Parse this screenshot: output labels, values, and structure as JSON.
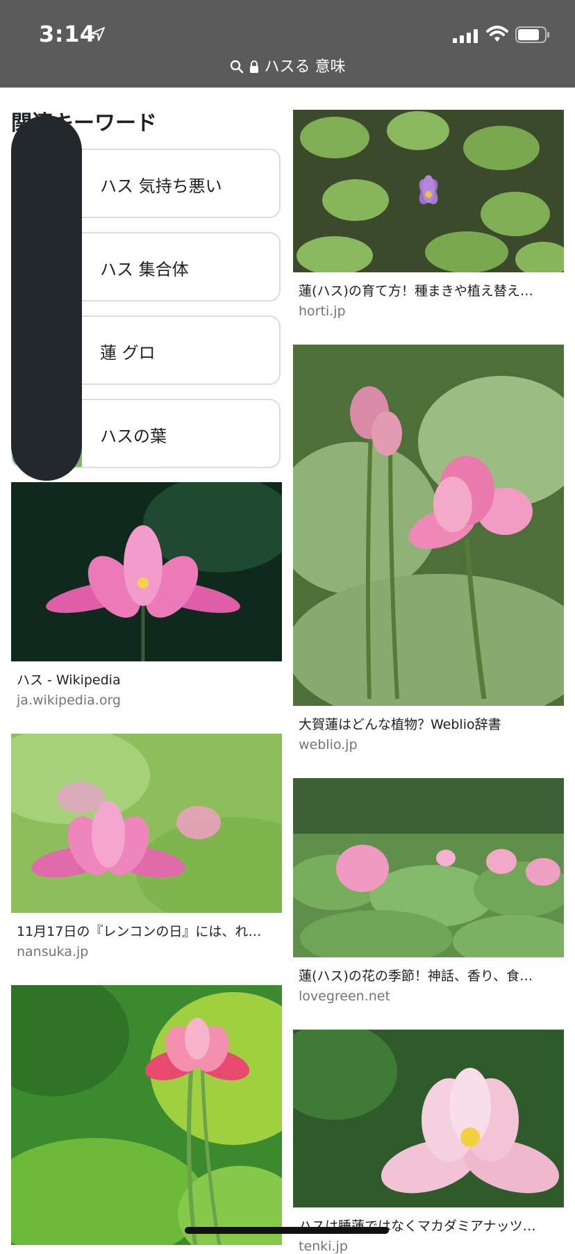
{
  "status": {
    "time": "3:14"
  },
  "urlbar": {
    "text": "ハスる 意味"
  },
  "related": {
    "title": "関連キーワード",
    "items": [
      {
        "label": "ハス 気持ち悪い"
      },
      {
        "label": "ハス 集合体"
      },
      {
        "label": "蓮 グロ"
      },
      {
        "label": "ハスの葉"
      }
    ]
  },
  "results": [
    {
      "caption": "蓮(ハス)の育て方！種まきや植え替え…",
      "source": "horti.jp"
    },
    {
      "caption": "ハス - Wikipedia",
      "source": "ja.wikipedia.org"
    },
    {
      "caption": "大賀蓮はどんな植物？Weblio辞書",
      "source": "weblio.jp"
    },
    {
      "caption": "11月17日の『レンコンの日』には、れ…",
      "source": "nansuka.jp"
    },
    {
      "caption": "蓮(ハス)の花の季節！神話、香り、食…",
      "source": "lovegreen.net"
    },
    {
      "caption": "ハスは睡蓮ではなくマカダミアナッツ…",
      "source": "tenki.jp"
    }
  ],
  "colors": {
    "topbar": "#5b5b5b",
    "redaction": "#23282d"
  }
}
